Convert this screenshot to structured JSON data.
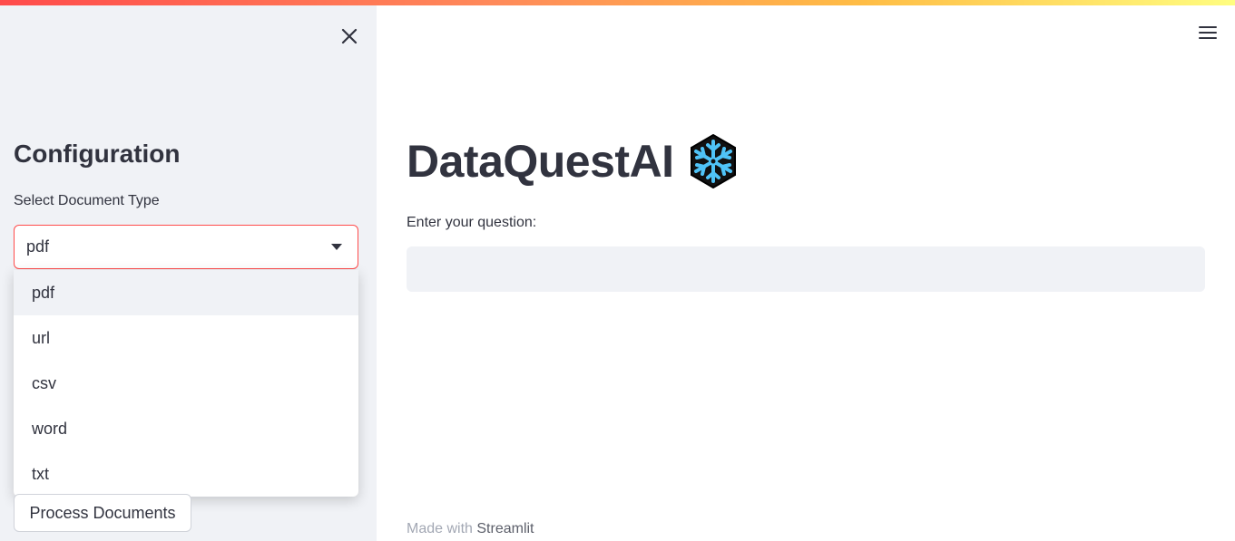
{
  "sidebar": {
    "heading": "Configuration",
    "doc_type_label": "Select Document Type",
    "doc_type_selected": "pdf",
    "doc_type_options": [
      "pdf",
      "url",
      "csv",
      "word",
      "txt"
    ],
    "process_button": "Process Documents"
  },
  "main": {
    "title": "DataQuestAI",
    "title_icon": "snowflake-icon",
    "question_label": "Enter your question:",
    "question_value": ""
  },
  "footer": {
    "prefix": "Made with",
    "link": "Streamlit"
  },
  "colors": {
    "accent": "#ff4b4b",
    "sidebar_bg": "#f0f2f6",
    "text": "#31333f",
    "snowflake": "#4fc3f7"
  }
}
